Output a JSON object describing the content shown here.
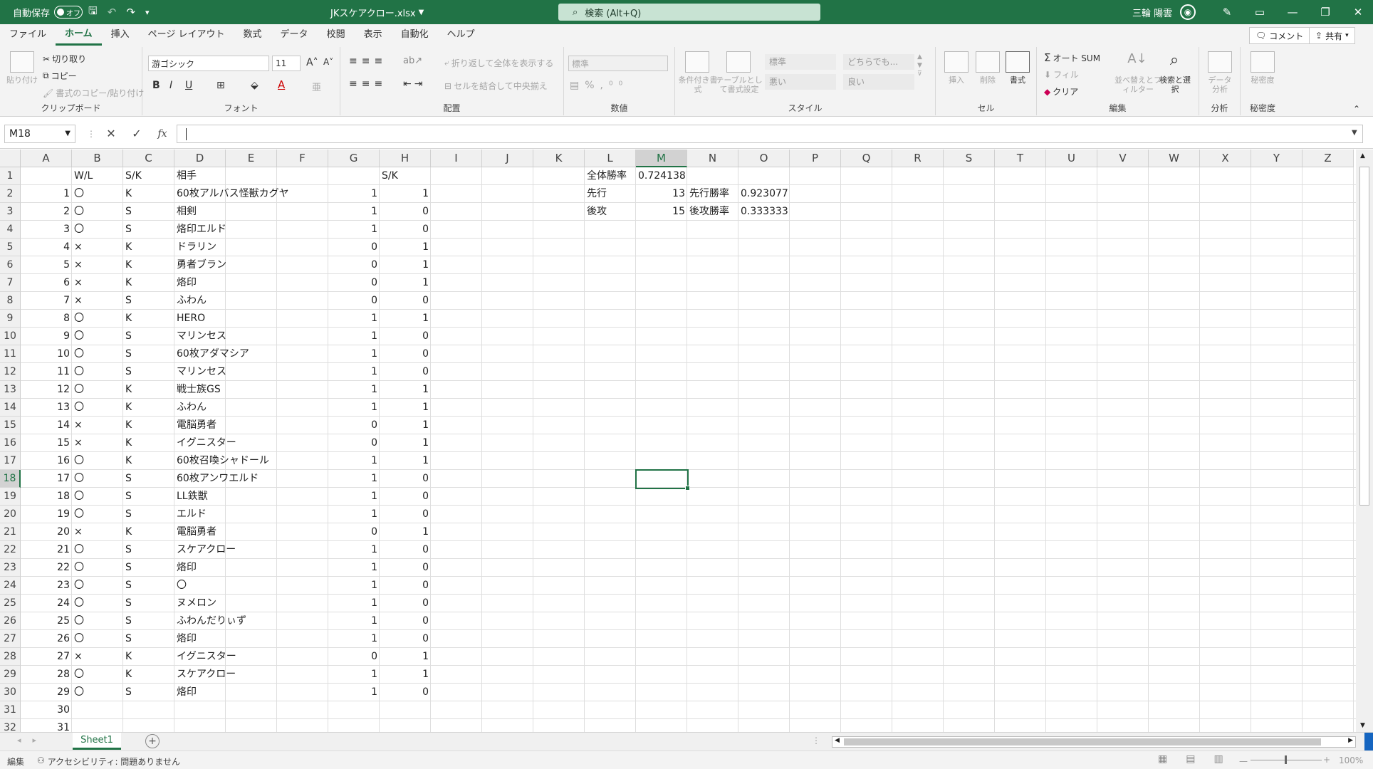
{
  "titlebar": {
    "autosave_label": "自動保存",
    "autosave_state": "オフ",
    "file_name": "JKスケアクロー.xlsx",
    "search_placeholder": "検索 (Alt+Q)",
    "user_name": "三輪 陽雲"
  },
  "tabs": [
    "ファイル",
    "ホーム",
    "挿入",
    "ページ レイアウト",
    "数式",
    "データ",
    "校閲",
    "表示",
    "自動化",
    "ヘルプ"
  ],
  "active_tab": "ホーム",
  "tab_right": {
    "comment": "コメント",
    "share": "共有"
  },
  "ribbon": {
    "clipboard": {
      "label": "クリップボード",
      "paste": "貼り付け",
      "cut": "切り取り",
      "copy": "コピー",
      "format_painter": "書式のコピー/貼り付け"
    },
    "font": {
      "label": "フォント",
      "font_name": "游ゴシック",
      "font_size": "11",
      "bold": "B",
      "italic": "I",
      "underline": "U"
    },
    "alignment": {
      "label": "配置",
      "wrap": "折り返して全体を表示する",
      "merge": "セルを結合して中央揃え"
    },
    "number": {
      "label": "数値",
      "format": "標準"
    },
    "styles": {
      "label": "スタイル",
      "cond_fmt": "条件付き書式",
      "table_fmt": "テーブルとして書式設定",
      "s1": "標準",
      "s2": "どちらでも...",
      "s3": "悪い",
      "s4": "良い"
    },
    "cells": {
      "label": "セル",
      "insert": "挿入",
      "delete": "削除",
      "format": "書式"
    },
    "editing": {
      "label": "編集",
      "autosum": "オート SUM",
      "fill": "フィル",
      "clear": "クリア",
      "sort_filter": "並べ替えとフィルター",
      "find_select": "検索と選択"
    },
    "analysis": {
      "label": "分析",
      "data_analysis": "データ分析"
    },
    "sensitivity": {
      "label": "秘密度",
      "sensitivity": "秘密度"
    }
  },
  "formula_bar": {
    "name_box": "M18",
    "value": ""
  },
  "columns": [
    "A",
    "B",
    "C",
    "D",
    "E",
    "F",
    "G",
    "H",
    "I",
    "J",
    "K",
    "L",
    "M",
    "N",
    "O",
    "P",
    "Q",
    "R",
    "S",
    "T",
    "U",
    "V",
    "W",
    "X",
    "Y",
    "Z"
  ],
  "selected_column": "M",
  "selected_row": "18",
  "header_row": {
    "B": "W/L",
    "C": "S/K",
    "D": "相手",
    "H": "S/K"
  },
  "rows": [
    {
      "a": "1",
      "b": "〇",
      "c": "K",
      "d": "60枚アルバス怪獣カグヤ",
      "g": "1",
      "h": "1"
    },
    {
      "a": "2",
      "b": "〇",
      "c": "S",
      "d": "相剣",
      "g": "1",
      "h": "0"
    },
    {
      "a": "3",
      "b": "〇",
      "c": "S",
      "d": "烙印エルド",
      "g": "1",
      "h": "0"
    },
    {
      "a": "4",
      "b": "×",
      "c": "K",
      "d": "ドラリン",
      "g": "0",
      "h": "1"
    },
    {
      "a": "5",
      "b": "×",
      "c": "K",
      "d": "勇者ブラン",
      "g": "0",
      "h": "1"
    },
    {
      "a": "6",
      "b": "×",
      "c": "K",
      "d": "烙印",
      "g": "0",
      "h": "1"
    },
    {
      "a": "7",
      "b": "×",
      "c": "S",
      "d": "ふわん",
      "g": "0",
      "h": "0"
    },
    {
      "a": "8",
      "b": "〇",
      "c": "K",
      "d": "HERO",
      "g": "1",
      "h": "1"
    },
    {
      "a": "9",
      "b": "〇",
      "c": "S",
      "d": "マリンセス",
      "g": "1",
      "h": "0"
    },
    {
      "a": "10",
      "b": "〇",
      "c": "S",
      "d": "60枚アダマシア",
      "g": "1",
      "h": "0"
    },
    {
      "a": "11",
      "b": "〇",
      "c": "S",
      "d": "マリンセス",
      "g": "1",
      "h": "0"
    },
    {
      "a": "12",
      "b": "〇",
      "c": "K",
      "d": "戦士族GS",
      "g": "1",
      "h": "1"
    },
    {
      "a": "13",
      "b": "〇",
      "c": "K",
      "d": "ふわん",
      "g": "1",
      "h": "1"
    },
    {
      "a": "14",
      "b": "×",
      "c": "K",
      "d": "電脳勇者",
      "g": "0",
      "h": "1"
    },
    {
      "a": "15",
      "b": "×",
      "c": "K",
      "d": "イグニスター",
      "g": "0",
      "h": "1"
    },
    {
      "a": "16",
      "b": "〇",
      "c": "K",
      "d": "60枚召喚シャドール",
      "g": "1",
      "h": "1"
    },
    {
      "a": "17",
      "b": "〇",
      "c": "S",
      "d": "60枚アンワエルド",
      "g": "1",
      "h": "0"
    },
    {
      "a": "18",
      "b": "〇",
      "c": "S",
      "d": "LL鉄獣",
      "g": "1",
      "h": "0"
    },
    {
      "a": "19",
      "b": "〇",
      "c": "S",
      "d": "エルド",
      "g": "1",
      "h": "0"
    },
    {
      "a": "20",
      "b": "×",
      "c": "K",
      "d": "電脳勇者",
      "g": "0",
      "h": "1"
    },
    {
      "a": "21",
      "b": "〇",
      "c": "S",
      "d": "スケアクロー",
      "g": "1",
      "h": "0"
    },
    {
      "a": "22",
      "b": "〇",
      "c": "S",
      "d": "烙印",
      "g": "1",
      "h": "0"
    },
    {
      "a": "23",
      "b": "〇",
      "c": "S",
      "d": "〇",
      "g": "1",
      "h": "0"
    },
    {
      "a": "24",
      "b": "〇",
      "c": "S",
      "d": "ヌメロン",
      "g": "1",
      "h": "0"
    },
    {
      "a": "25",
      "b": "〇",
      "c": "S",
      "d": "ふわんだりぃず",
      "g": "1",
      "h": "0"
    },
    {
      "a": "26",
      "b": "〇",
      "c": "S",
      "d": "烙印",
      "g": "1",
      "h": "0"
    },
    {
      "a": "27",
      "b": "×",
      "c": "K",
      "d": "イグニスター",
      "g": "0",
      "h": "1"
    },
    {
      "a": "28",
      "b": "〇",
      "c": "K",
      "d": "スケアクロー",
      "g": "1",
      "h": "1"
    },
    {
      "a": "29",
      "b": "〇",
      "c": "S",
      "d": "烙印",
      "g": "1",
      "h": "0"
    },
    {
      "a": "30",
      "b": "",
      "c": "",
      "d": "",
      "g": "",
      "h": ""
    },
    {
      "a": "31",
      "b": "",
      "c": "",
      "d": "",
      "g": "",
      "h": ""
    },
    {
      "a": "",
      "b": "",
      "c": "",
      "d": "",
      "g": "",
      "h": ""
    }
  ],
  "summary": {
    "overall_label": "全体勝率",
    "overall_value": "0.724138",
    "first_label": "先行",
    "first_count": "13",
    "first_rate_label": "先行勝率",
    "first_rate": "0.923077",
    "second_label": "後攻",
    "second_count": "15",
    "second_rate_label": "後攻勝率",
    "second_rate": "0.333333"
  },
  "sheet_tab": "Sheet1",
  "status": {
    "mode": "編集",
    "accessibility": "アクセシビリティ: 問題ありません",
    "zoom": "100%"
  },
  "colors": {
    "accent": "#217346"
  }
}
